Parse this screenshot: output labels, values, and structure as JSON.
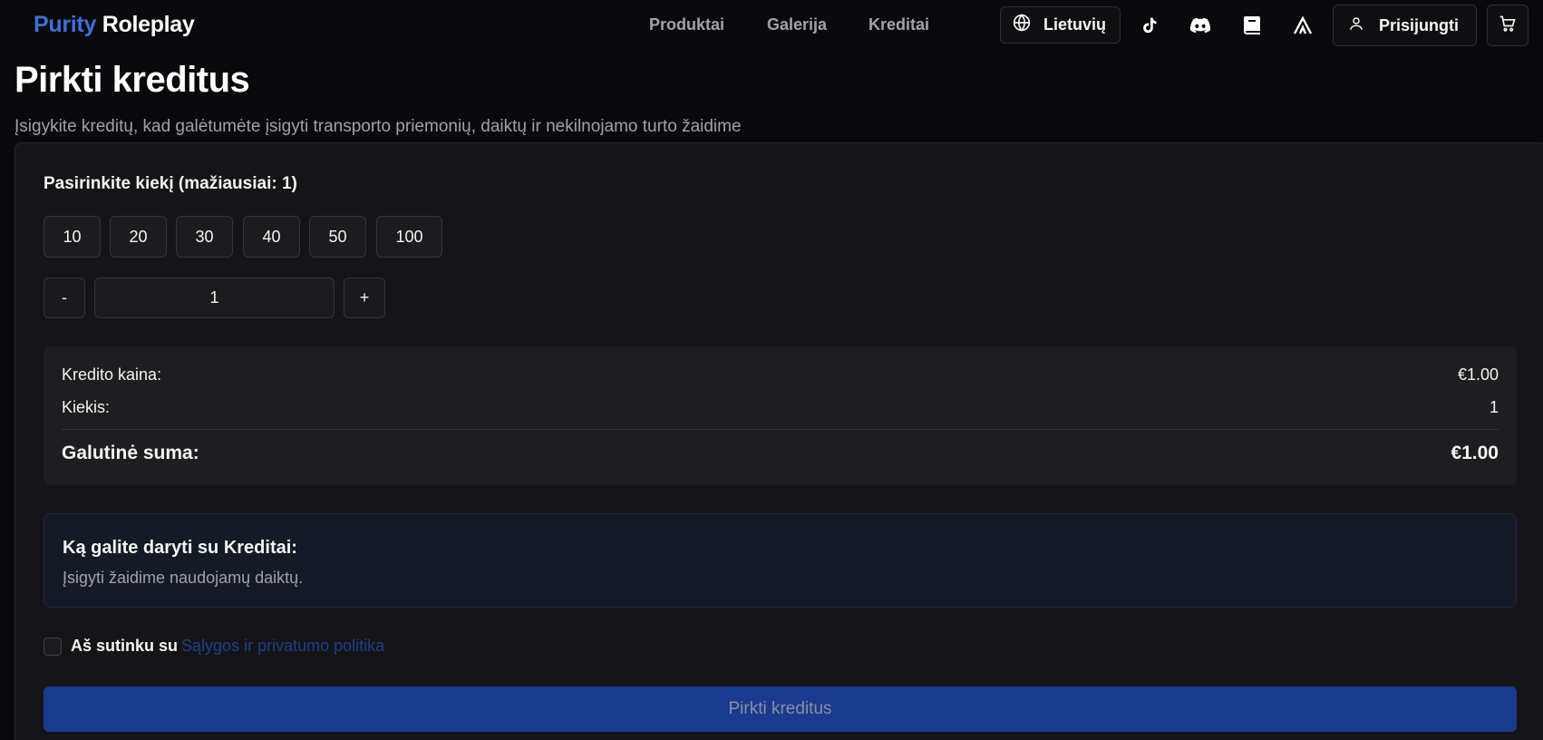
{
  "header": {
    "logo_part1": "Purity",
    "logo_part2": "Roleplay",
    "nav": [
      "Produktai",
      "Galerija",
      "Kreditai"
    ],
    "language_label": "Lietuvių",
    "social_icons": [
      "tiktok-icon",
      "discord-icon",
      "book-icon",
      "forum-icon"
    ],
    "login_label": "Prisijungti"
  },
  "page": {
    "title": "Pirkti kreditus",
    "subtitle": "Įsigykite kreditų, kad galėtumėte įsigyti transporto priemonių, daiktų ir nekilnojamo turto žaidime"
  },
  "quantity": {
    "label": "Pasirinkite kiekį (mažiausiai: 1)",
    "presets": [
      "10",
      "20",
      "30",
      "40",
      "50",
      "100"
    ],
    "minus": "-",
    "plus": "+",
    "value": "1"
  },
  "summary": {
    "price_label": "Kredito kaina:",
    "price_value": "€1.00",
    "qty_label": "Kiekis:",
    "qty_value": "1",
    "total_label": "Galutinė suma:",
    "total_value": "€1.00"
  },
  "info": {
    "title": "Ką galite daryti su Kreditai:",
    "text": "Įsigyti žaidime naudojamų daiktų."
  },
  "agreement": {
    "prefix": "Aš sutinku su",
    "link": "Sąlygos ir privatumo politika"
  },
  "buy_button": "Pirkti kreditus",
  "colors": {
    "accent": "#3e6fd8",
    "button": "#1a3a8f",
    "background": "#0a0a0c"
  }
}
